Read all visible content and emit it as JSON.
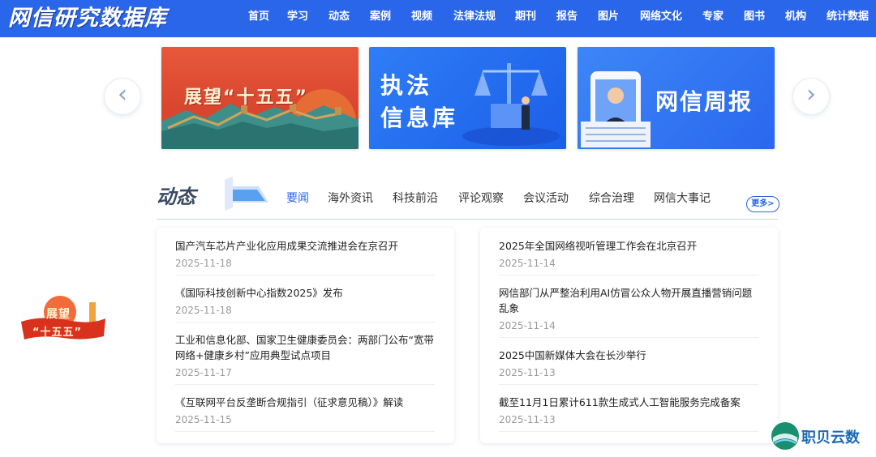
{
  "header": {
    "logo": "网信研究数据库",
    "nav": [
      "首页",
      "学习",
      "动态",
      "案例",
      "视频",
      "法律法规",
      "期刊",
      "报告",
      "图片",
      "网络文化",
      "专家",
      "图书",
      "机构",
      "统计数据"
    ]
  },
  "banner": {
    "prev_icon": "chevron-left-icon",
    "next_icon": "chevron-right-icon",
    "slides": [
      {
        "text": "展望“十五五”"
      },
      {
        "line1": "执法",
        "line2": "信息库"
      },
      {
        "text": "网信周报"
      }
    ]
  },
  "section": {
    "title": "动态",
    "tabs": [
      "要闻",
      "海外资讯",
      "科技前沿",
      "评论观察",
      "会议活动",
      "综合治理",
      "网信大事记"
    ],
    "active_tab": "要闻",
    "more": "更多>",
    "accent_color": "#2a66ea"
  },
  "news_left": [
    {
      "title": "国产汽车芯片产业化应用成果交流推进会在京召开",
      "date": "2025-11-18"
    },
    {
      "title": "《国际科技创新中心指数2025》发布",
      "date": "2025-11-18"
    },
    {
      "title": "工业和信息化部、国家卫生健康委员会：两部门公布“宽带网络+健康乡村”应用典型试点项目",
      "date": "2025-11-17"
    },
    {
      "title": "《互联网平台反垄断合规指引（征求意见稿）》解读",
      "date": "2025-11-15"
    }
  ],
  "news_right": [
    {
      "title": "2025年全国网络视听管理工作会在北京召开",
      "date": "2025-11-14"
    },
    {
      "title": "网信部门从严整治利用AI仿冒公众人物开展直播营销问题乱象",
      "date": "2025-11-14"
    },
    {
      "title": "2025中国新媒体大会在长沙举行",
      "date": "2025-11-13"
    },
    {
      "title": "截至11月1日累计611款生成式人工智能服务完成备案",
      "date": "2025-11-13"
    }
  ],
  "float_badge": {
    "line1": "展望",
    "line2": "“十五五”"
  },
  "watermark": {
    "text": "职贝云数"
  }
}
